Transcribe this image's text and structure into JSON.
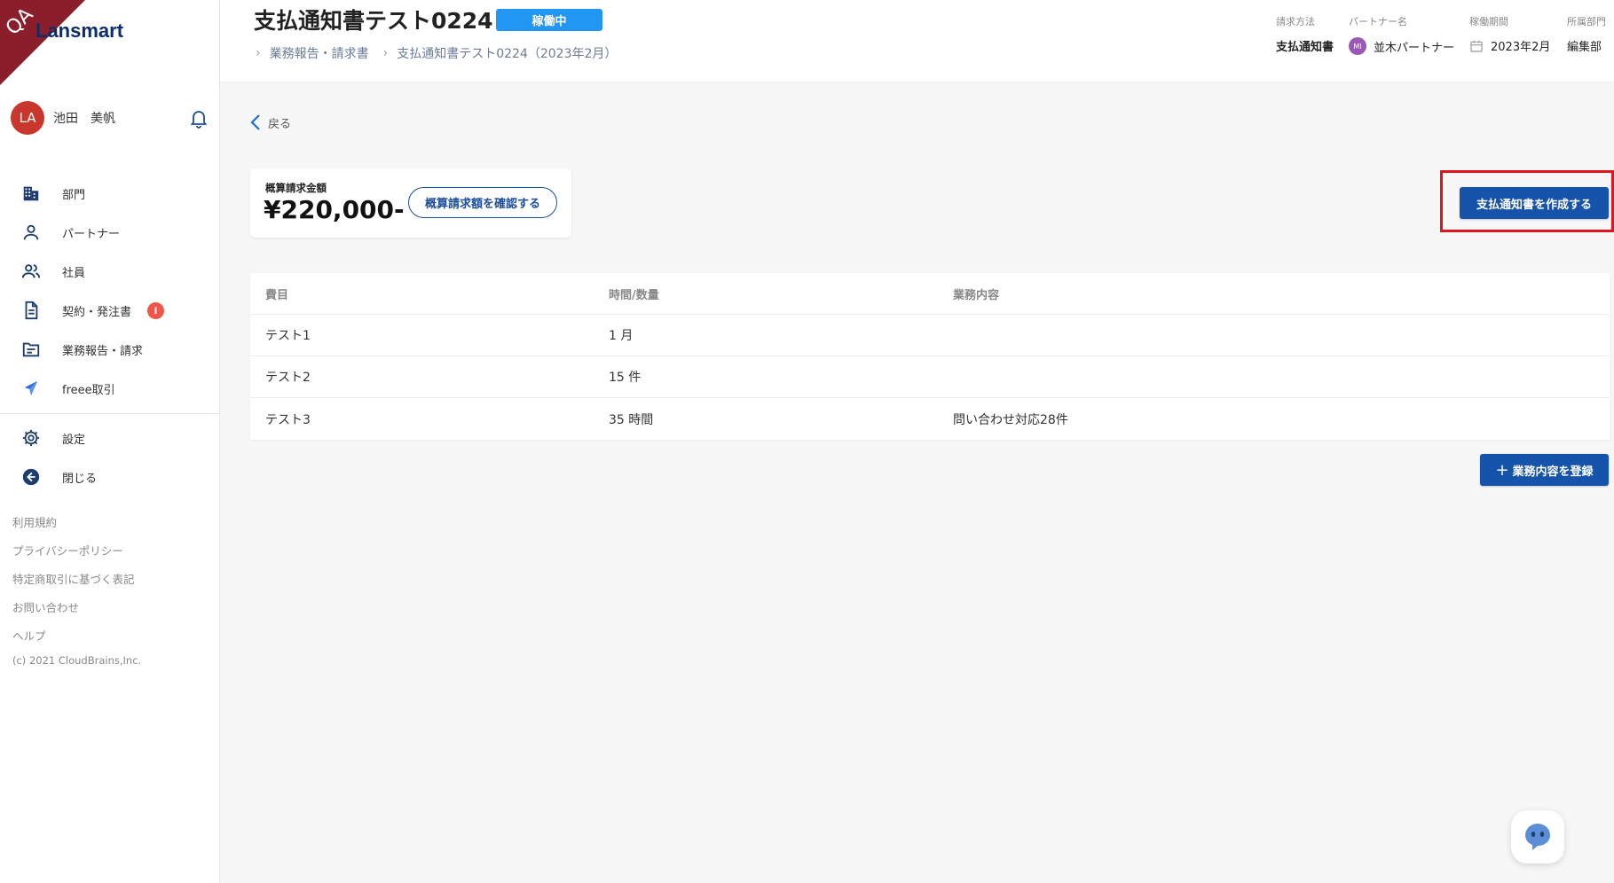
{
  "brand": {
    "logo_text": "Lansmart",
    "qa_label": "QA"
  },
  "user": {
    "initials": "LA",
    "name": "池田　美帆"
  },
  "sidebar": {
    "items": [
      {
        "label": "部門",
        "icon": "building-icon"
      },
      {
        "label": "パートナー",
        "icon": "person-icon"
      },
      {
        "label": "社員",
        "icon": "people-icon"
      },
      {
        "label": "契約・発注書",
        "icon": "document-icon",
        "badge": "i"
      },
      {
        "label": "業務報告・請求",
        "icon": "folder-icon"
      },
      {
        "label": "freee取引",
        "icon": "freee-icon"
      }
    ],
    "settings_label": "設定",
    "close_label": "閉じる",
    "footer_links": [
      "利用規約",
      "プライバシーポリシー",
      "特定商取引に基づく表記",
      "お問い合わせ",
      "ヘルプ"
    ],
    "copyright": "(c) 2021 CloudBrains,Inc."
  },
  "header": {
    "title": "支払通知書テスト0224",
    "status": "稼働中",
    "breadcrumb": [
      "業務報告・請求書",
      "支払通知書テスト0224（2023年2月）"
    ],
    "meta": {
      "billing_method_label": "請求方法",
      "billing_method_value": "支払通知書",
      "partner_label": "パートナー名",
      "partner_initials": "MI",
      "partner_value": "並木パートナー",
      "period_label": "稼働期間",
      "period_value": "2023年2月",
      "department_label": "所属部門",
      "department_value": "編集部"
    }
  },
  "main": {
    "back_label": "戻る",
    "summary": {
      "label": "概算請求金額",
      "amount": "¥220,000-",
      "confirm_button": "概算請求額を確認する"
    },
    "create_button": "支払通知書を作成する",
    "table": {
      "headers": [
        "費目",
        "時間/数量",
        "業務内容"
      ],
      "rows": [
        [
          "テスト1",
          "1 月",
          ""
        ],
        [
          "テスト2",
          "15 件",
          ""
        ],
        [
          "テスト3",
          "35 時間",
          "問い合わせ対応28件"
        ]
      ]
    },
    "register_button": "業務内容を登録"
  },
  "colors": {
    "primary": "#1554aa",
    "status": "#2196f3",
    "highlight": "#e0141e",
    "avatar": "#c9372c"
  }
}
